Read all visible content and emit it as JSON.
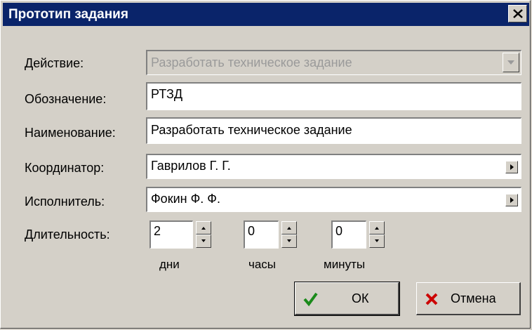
{
  "dialog": {
    "title": "Прототип задания"
  },
  "form": {
    "action_label": "Действие:",
    "action_value": "Разработать техническое задание",
    "designation_label": "Обозначение:",
    "designation_value": "РТЗД",
    "name_label": "Наименование:",
    "name_value": "Разработать техническое задание",
    "coordinator_label": "Координатор:",
    "coordinator_value": "Гаврилов Г. Г.",
    "executor_label": "Исполнитель:",
    "executor_value": "Фокин Ф. Ф.",
    "duration_label": "Длительность:",
    "days_value": "2",
    "days_label": "дни",
    "hours_value": "0",
    "hours_label": "часы",
    "minutes_value": "0",
    "minutes_label": "минуты"
  },
  "buttons": {
    "ok_label": "ОК",
    "cancel_label": "Отмена"
  },
  "icons": {
    "close": "close-icon",
    "ok": "check-icon",
    "cancel": "cross-icon",
    "dropdown": "dropdown-arrow-icon",
    "lookup": "arrow-right-icon"
  },
  "colors": {
    "titlebar": "#0a246a",
    "face": "#d4d0c8",
    "ok_check": "#1a8a1a",
    "cancel_cross": "#cc0000"
  }
}
